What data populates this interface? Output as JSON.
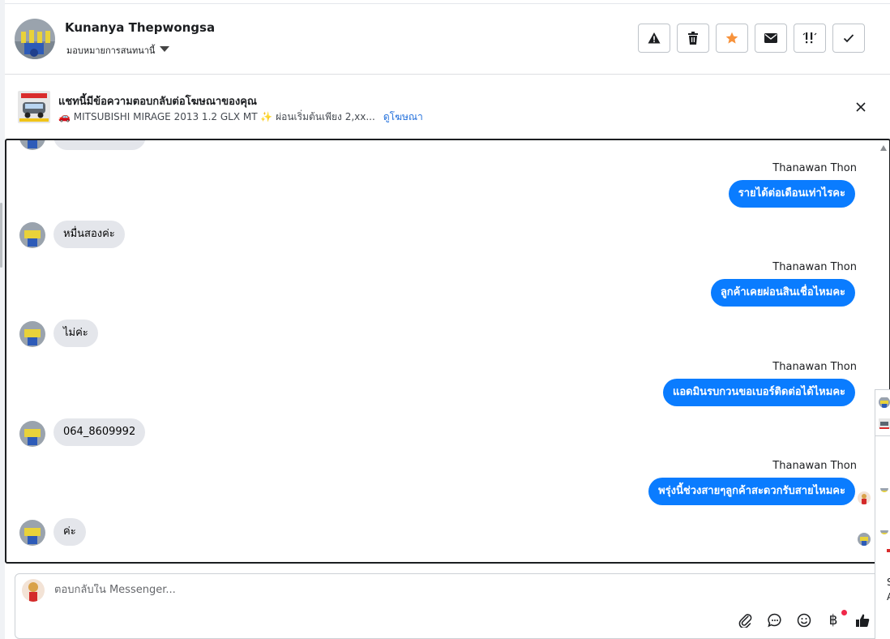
{
  "header": {
    "contact_name": "Kunanya Thepwongsa",
    "assign_label": "มอบหมายการสนทนานี้",
    "actions": [
      {
        "name": "warning-icon",
        "label": "!"
      },
      {
        "name": "trash-icon",
        "label": "delete"
      },
      {
        "name": "star-icon",
        "label": "star",
        "color": "#f7923b"
      },
      {
        "name": "envelope-icon",
        "label": "mail"
      },
      {
        "name": "follow-up-icon",
        "label": "!!"
      },
      {
        "name": "check-icon",
        "label": "done"
      }
    ]
  },
  "ad": {
    "title": "แชทนี้มีข้อความตอบกลับต่อโฆษณาของคุณ",
    "subtitle": "🚗 MITSUBISHI MIRAGE 2013 1.2 GLX MT ✨ ผ่อนเริ่มต้นเพียง 2,xx...",
    "link_label": "ดูโฆษณา"
  },
  "conversation": {
    "messages": [
      {
        "type": "out",
        "sender": "Thanawan Thon",
        "text": "รายได้ต่อเดือนเท่าไรคะ"
      },
      {
        "type": "in",
        "text": "หมื่นสองค่ะ"
      },
      {
        "type": "out",
        "sender": "Thanawan Thon",
        "text": "ลูกค้าเคยผ่อนสินเชื่อไหมคะ"
      },
      {
        "type": "in",
        "text": "ไม่ค่ะ"
      },
      {
        "type": "out",
        "sender": "Thanawan Thon",
        "text": "แอดมินรบกวนขอเบอร์ติดต่อได้ไหมคะ"
      },
      {
        "type": "in",
        "text": "064_8609992"
      },
      {
        "type": "out",
        "sender": "Thanawan Thon",
        "text": "พรุ่งนี้ช่วงสายๆลูกค้าสะดวกรับสายไหมคะ"
      },
      {
        "type": "in",
        "text": "ค่ะ"
      }
    ]
  },
  "reply": {
    "placeholder": "ตอบกลับใน Messenger...",
    "tools": [
      "paperclip-icon",
      "chat-bubble-icon",
      "emoji-icon",
      "baht-icon",
      "thumbs-up-icon"
    ],
    "baht_symbol": "฿"
  },
  "edge_panel": {
    "letter_1": "S",
    "letter_2": "A"
  },
  "colors": {
    "accent_blue": "#0a7cff",
    "link_blue": "#216fdb",
    "incoming_bubble": "#e4e6eb",
    "notification_dot": "#f02849"
  }
}
